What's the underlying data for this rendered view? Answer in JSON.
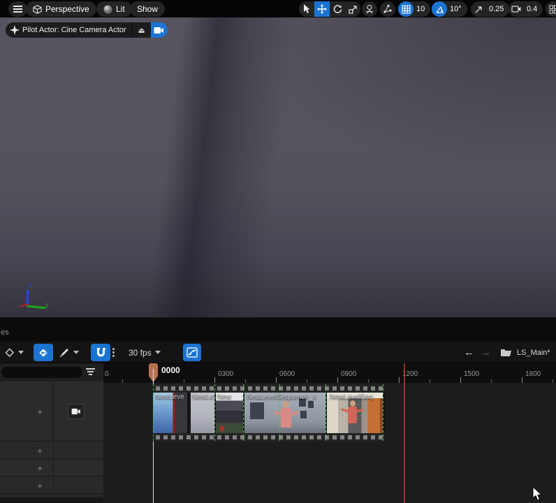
{
  "top_toolbar": {
    "perspective_label": "Perspective",
    "lit_label": "Lit",
    "show_label": "Show",
    "grid_snap_value": "10",
    "angle_snap_value": "10°",
    "scale_snap_value": "0.25",
    "camera_speed_value": "0.4"
  },
  "pilot_bar": {
    "label": "Pilot Actor: Cine Camera Actor"
  },
  "viewport": {
    "axis_z_label": "z",
    "axis_y_label": "y"
  },
  "panel_edge_text": "es",
  "sequencer_toolbar": {
    "fps_label": "30 fps",
    "sequence_name": "LS_Main*"
  },
  "track_panel": {
    "add_label": "+"
  },
  "timeline": {
    "playhead_time": "0000",
    "ruler_labels": [
      "0",
      "0300",
      "0600",
      "0900",
      "1200",
      "1500",
      "1800"
    ],
    "clips": [
      "NewLeve",
      "NewLe",
      "New",
      "NewLevelSequence_4",
      "NewLevelSeq"
    ]
  },
  "colors": {
    "accent_blue": "#1b74d2",
    "playhead_marker": "#b5724e",
    "range_end_line": "#b23834",
    "clip_boundary_green": "#49c455"
  }
}
